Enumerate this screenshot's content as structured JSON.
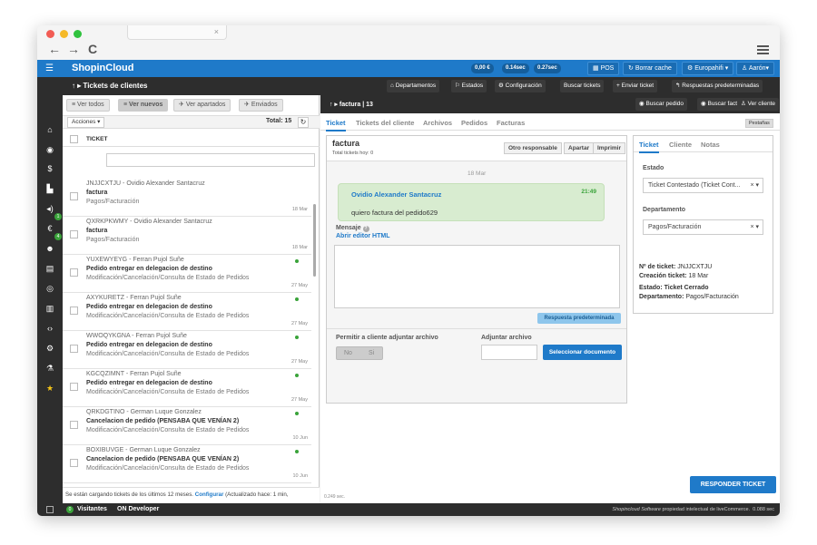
{
  "browser": {
    "tab_close": "×",
    "back": "←",
    "forward": "→",
    "reload": "C"
  },
  "topbar": {
    "brand": "ShopinCloud",
    "stat1": "0,00 €",
    "stat2": "0.14sec",
    "stat3": "0.27sec",
    "pos": "POS",
    "cache": "Borrar cache",
    "store": "Europahifi",
    "user": "Aarón"
  },
  "subbar": {
    "title": "Tickets de clientes",
    "dept": "Departamentos",
    "states": "Estados",
    "config": "Configuración",
    "search": "Buscar tickets",
    "send": "Enviar ticket",
    "canned": "Respuestas predeterminadas"
  },
  "list": {
    "view_all": "Ver todos",
    "view_new": "Ver nuevos",
    "view_assigned": "Ver apartados",
    "view_sent": "Enviados",
    "actions": "Acciones",
    "total": "Total: 15",
    "col_ticket": "TICKET",
    "items": [
      {
        "id": "JNJJCXTJU - Ovidio Alexander Santacruz",
        "subject": "factura",
        "category": "Pagos/Facturación",
        "date": "18 Mar",
        "dot": false
      },
      {
        "id": "QXRKPKWMY - Ovidio Alexander Santacruz",
        "subject": "factura",
        "category": "Pagos/Facturación",
        "date": "18 Mar",
        "dot": false
      },
      {
        "id": "YUXEWYEYG - Ferran Pujol Suñe",
        "subject": "Pedido entregar en delegacion de destino",
        "category": "Modificación/Cancelación/Consulta de Estado de Pedidos",
        "date": "27 May",
        "dot": true
      },
      {
        "id": "AXYKURETZ - Ferran Pujol Suñe",
        "subject": "Pedido entregar en delegacion de destino",
        "category": "Modificación/Cancelación/Consulta de Estado de Pedidos",
        "date": "27 May",
        "dot": true
      },
      {
        "id": "WWOQYKGNA - Ferran Pujol Suñe",
        "subject": "Pedido entregar en delegacion de destino",
        "category": "Modificación/Cancelación/Consulta de Estado de Pedidos",
        "date": "27 May",
        "dot": true
      },
      {
        "id": "KGCQZIMNT - Ferran Pujol Suñe",
        "subject": "Pedido entregar en delegacion de destino",
        "category": "Modificación/Cancelación/Consulta de Estado de Pedidos",
        "date": "27 May",
        "dot": true
      },
      {
        "id": "QRKDGTINO - German Luque Gonzalez",
        "subject": "Cancelacion de pedido (PENSABA QUE VENÍAN 2)",
        "category": "Modificación/Cancelación/Consulta de Estado de Pedidos",
        "date": "10 Jun",
        "dot": true
      },
      {
        "id": "BOXIBUVGE - German Luque Gonzalez",
        "subject": "Cancelacion de pedido (PENSABA QUE VENÍAN 2)",
        "category": "Modificación/Cancelación/Consulta de Estado de Pedidos",
        "date": "10 Jun",
        "dot": true
      }
    ],
    "footer_text": "Se están cargando tickets de los últimos 12 meses.",
    "footer_link": "Configurar",
    "footer_rest": "(Actualizado hace: 1 min,"
  },
  "detail": {
    "title": "factura | 13",
    "search_order": "Buscar pedido",
    "search_invoice": "Buscar factura",
    "view_client": "Ver cliente",
    "tabs": [
      "Ticket",
      "Tickets del cliente",
      "Archivos",
      "Pedidos",
      "Facturas"
    ],
    "tabs_right": "Pestañas",
    "subject": "factura",
    "total_today": "Total tickets hoy: 0",
    "other_resp": "Otro responsable",
    "apartar": "Apartar",
    "print": "Imprimir",
    "msg_date": "18 Mar",
    "msg_author": "Ovidio Alexander Santacruz",
    "msg_time": "21:49",
    "msg_text": "quiero factura del pedido629",
    "mensaje": "Mensaje",
    "editor": "Abrir editor HTML",
    "canned_btn": "Respuesta predeterminada",
    "allow_attach": "Permitir a cliente adjuntar archivo",
    "no": "No",
    "si": "Si",
    "attach": "Adjuntar archivo",
    "select_doc": "Seleccionar documento",
    "time": "0.249 sec.",
    "reply": "RESPONDER TICKET"
  },
  "info": {
    "tabs": [
      "Ticket",
      "Cliente",
      "Notas"
    ],
    "estado_label": "Estado",
    "estado_value": "Ticket Contestado (Ticket Cont...",
    "dept_label": "Departamento",
    "dept_value": "Pagos/Facturación",
    "ticket_no_label": "Nº de ticket:",
    "ticket_no": "JNJJCXTJU",
    "created_label": "Creación ticket:",
    "created": "18 Mar",
    "status_label": "Estado:",
    "status": "Ticket Cerrado",
    "dept2_label": "Departamento:",
    "dept2": "Pagos/Facturación"
  },
  "footer": {
    "visitors_count": "0",
    "visitors": "Visitantes",
    "developer": "ON Developer",
    "credit_brand": "Shopincloud Software",
    "credit": "propiedad intelectual de liveCommerce.",
    "credit_time": "0.088 sec"
  },
  "colors": {
    "blue": "#1f7ac9",
    "dark": "#2d2d2d",
    "green": "#3aa33a"
  }
}
